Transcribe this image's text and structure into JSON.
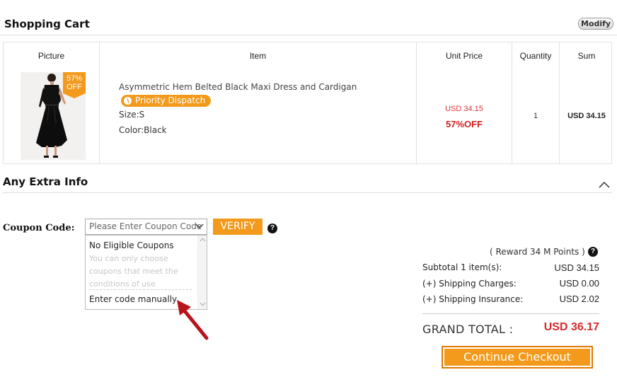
{
  "header": {
    "title": "Shopping Cart",
    "modify_label": "Modify"
  },
  "table": {
    "columns": [
      "Picture",
      "Item",
      "Unit Price",
      "Quantity",
      "Sum"
    ],
    "item": {
      "badge_percent": "57%",
      "badge_off": "OFF",
      "name": "Asymmetric Hem Belted Black Maxi Dress and Cardigan",
      "dispatch": "Priority Dispatch",
      "size": "Size:S",
      "color": "Color:Black",
      "unit_price": "USD 34.15",
      "discount": "57%OFF",
      "quantity": "1",
      "sum": "USD 34.15"
    }
  },
  "extra": {
    "title": "Any Extra Info"
  },
  "coupon": {
    "label": "Coupon Code:",
    "placeholder": "Please Enter Coupon Code",
    "verify_label": "VERIFY",
    "dropdown": {
      "no_coupons": "No Eligible Coupons",
      "hint": "You can only choose coupons that meet the conditions of use",
      "manual": "Enter code manually"
    }
  },
  "summary": {
    "reward": "( Reward 34 M Points )",
    "subtotal_label": "Subtotal 1 item(s):",
    "subtotal_value": "USD 34.15",
    "shipping_label": "(+) Shipping Charges:",
    "shipping_value": "USD 0.00",
    "insurance_label": "(+) Shipping Insurance:",
    "insurance_value": "USD 2.02",
    "grand_label": "GRAND TOTAL :",
    "grand_value": "USD 36.17",
    "checkout_label": "Continue Checkout"
  },
  "colors": {
    "accent": "#f39a1c",
    "price_red": "#d42a2a"
  },
  "icons": [
    "clock-icon",
    "help-icon",
    "chevron-up-icon",
    "chevron-down-icon",
    "red-arrow-icon"
  ]
}
